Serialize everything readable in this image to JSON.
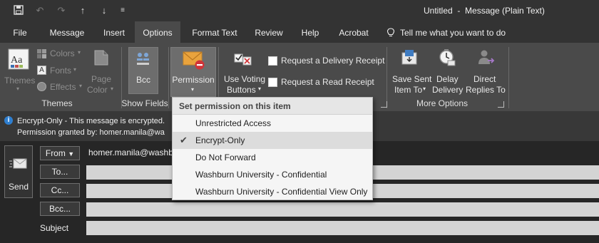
{
  "window": {
    "title": "Untitled  -  Message (Plain Text)",
    "tell_me": "Tell me what you want to do"
  },
  "tabs": [
    "File",
    "Message",
    "Insert",
    "Options",
    "Format Text",
    "Review",
    "Help",
    "Acrobat"
  ],
  "active_tab": "Options",
  "ribbon": {
    "themes": {
      "themes_button": "Themes",
      "colors": "Colors",
      "fonts": "Fonts",
      "effects": "Effects",
      "page_color_1": "Page",
      "page_color_2": "Color",
      "group_label": "Themes"
    },
    "show_fields": {
      "bcc": "Bcc",
      "group_label": "Show Fields"
    },
    "permission": {
      "label": "Permission"
    },
    "more_options": {
      "use_voting_1": "Use Voting",
      "use_voting_2": "Buttons",
      "delivery_receipt": "Request a Delivery Receipt",
      "read_receipt": "Request a Read Receipt",
      "save_sent_1": "Save Sent",
      "save_sent_2": "Item To",
      "delay_1": "Delay",
      "delay_2": "Delivery",
      "direct_1": "Direct",
      "direct_2": "Replies To",
      "group_label": "More Options"
    }
  },
  "infobar": {
    "line1": "Encrypt-Only - This message is encrypted.",
    "line2": "Permission granted by: homer.manila@wa"
  },
  "compose": {
    "send": "Send",
    "from_button": "From",
    "from_value": "homer.manila@washb",
    "to_button": "To...",
    "cc_button": "Cc...",
    "bcc_button": "Bcc...",
    "subject_label": "Subject"
  },
  "permission_menu": {
    "header": "Set permission on this item",
    "items": [
      "Unrestricted Access",
      "Encrypt-Only",
      "Do Not Forward",
      "Washburn University - Confidential",
      "Washburn University - Confidential View Only"
    ],
    "checked_item": "Encrypt-Only"
  },
  "colors": {
    "ribbon_bg": "#4a4a4a",
    "titlebar_bg": "#333333",
    "permission_icon": "#e9a33d",
    "permission_badge": "#d13438",
    "info_icon": "#2f7fd0"
  },
  "icons": {
    "save": "save-icon",
    "undo": "undo-icon",
    "redo": "redo-icon",
    "up": "up-arrow-icon",
    "down": "down-arrow-icon",
    "customize": "customize-qat-icon",
    "bulb": "lightbulb-icon",
    "info": "info-icon",
    "check": "checkmark-icon"
  }
}
